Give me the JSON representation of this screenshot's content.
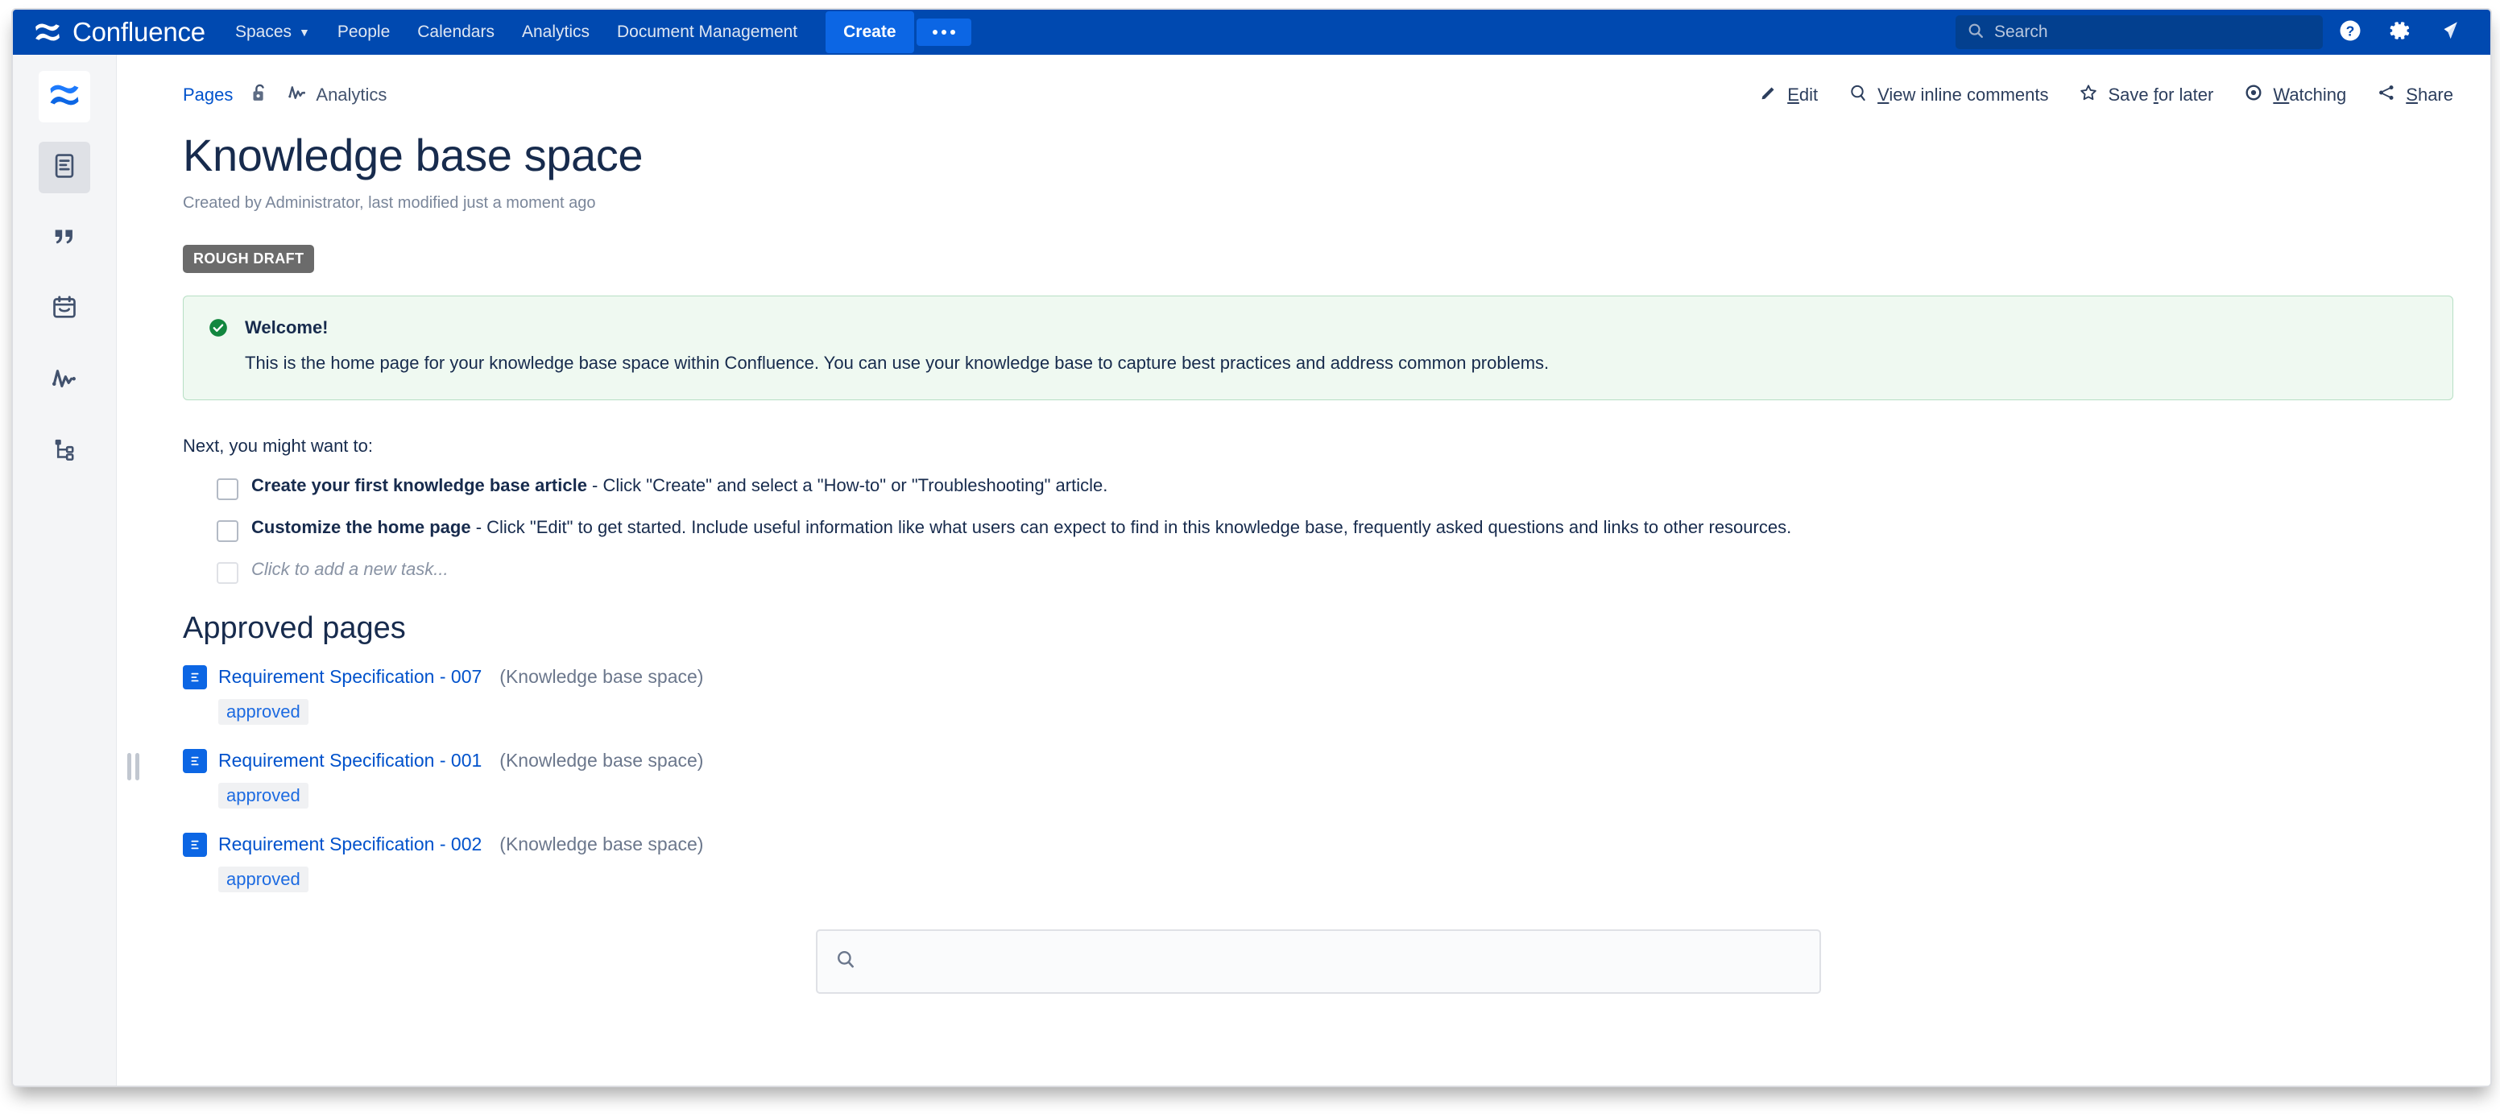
{
  "nav": {
    "brand": "Confluence",
    "brand_logo_icon": "confluence-logo-icon",
    "items": [
      {
        "label": "Spaces",
        "has_chevron": true
      },
      {
        "label": "People",
        "has_chevron": false
      },
      {
        "label": "Calendars",
        "has_chevron": false
      },
      {
        "label": "Analytics",
        "has_chevron": false
      },
      {
        "label": "Document Management",
        "has_chevron": false
      }
    ],
    "create_label": "Create",
    "more_label": "•••",
    "search_placeholder": "Search",
    "search_value": "",
    "icons": [
      "help-icon",
      "gear-icon",
      "notification-icon"
    ],
    "bg_color": "#0049B0",
    "create_color": "#0C66E4"
  },
  "rail": {
    "items": [
      {
        "name": "space-home",
        "icon": "confluence-space-icon",
        "active": false
      },
      {
        "name": "pages",
        "icon": "page-document-icon",
        "active": true
      },
      {
        "name": "blog",
        "icon": "quote-icon",
        "active": false
      },
      {
        "name": "calendars",
        "icon": "calendar-icon",
        "active": false
      },
      {
        "name": "analytics",
        "icon": "analytics-pulse-icon",
        "active": false
      },
      {
        "name": "page-tree",
        "icon": "page-tree-icon",
        "active": false
      }
    ]
  },
  "breadcrumb": {
    "pages_label": "Pages",
    "restrictions_icon": "unlocked-padlock-icon",
    "analytics_label": "Analytics",
    "analytics_icon": "analytics-pulse-icon"
  },
  "page_actions": [
    {
      "label": "Edit",
      "accesskey": "E",
      "icon": "pencil-icon"
    },
    {
      "label": "View inline comments",
      "accesskey": "V",
      "icon": "comment-search-icon"
    },
    {
      "label": "Save for later",
      "accesskey": "f",
      "icon": "star-icon"
    },
    {
      "label": "Watching",
      "accesskey": "W",
      "icon": "eye-icon"
    },
    {
      "label": "Share",
      "accesskey": "S",
      "icon": "share-icon"
    }
  ],
  "page": {
    "title": "Knowledge base space",
    "meta": "Created by Administrator, last modified just a moment ago",
    "draft_badge": "ROUGH DRAFT"
  },
  "welcome_panel": {
    "status_icon": "success-check-icon",
    "title": "Welcome!",
    "text": "This is the home page for your knowledge base space within Confluence. You can use your knowledge base to capture best practices and address common problems.",
    "bg_color": "#EFF9F1",
    "border_color": "#B7DFC4",
    "icon_color": "#12873F"
  },
  "tasks_section": {
    "intro": "Next, you might want to:",
    "tasks": [
      {
        "bold": "Create your first knowledge base article",
        "rest": " - Click \"Create\" and select a \"How-to\" or \"Troubleshooting\" article.",
        "checked": false,
        "placeholder": false
      },
      {
        "bold": "Customize the home page",
        "rest": " - Click \"Edit\" to get started. Include useful information like what users can expect to find in this knowledge base, frequently asked questions and links to other resources.",
        "checked": false,
        "placeholder": false
      },
      {
        "bold": "",
        "rest": "Click to add a new task...",
        "checked": false,
        "placeholder": true
      }
    ]
  },
  "approved_pages": {
    "title": "Approved pages",
    "items": [
      {
        "icon": "page-document-icon",
        "title": "Requirement Specification - 007",
        "space": "(Knowledge base space)",
        "status": "approved"
      },
      {
        "icon": "page-document-icon",
        "title": "Requirement Specification - 001",
        "space": "(Knowledge base space)",
        "status": "approved"
      },
      {
        "icon": "page-document-icon",
        "title": "Requirement Specification - 002",
        "space": "(Knowledge base space)",
        "status": "approved"
      }
    ]
  },
  "bottom_search": {
    "icon": "search-icon",
    "value": "",
    "placeholder": ""
  }
}
